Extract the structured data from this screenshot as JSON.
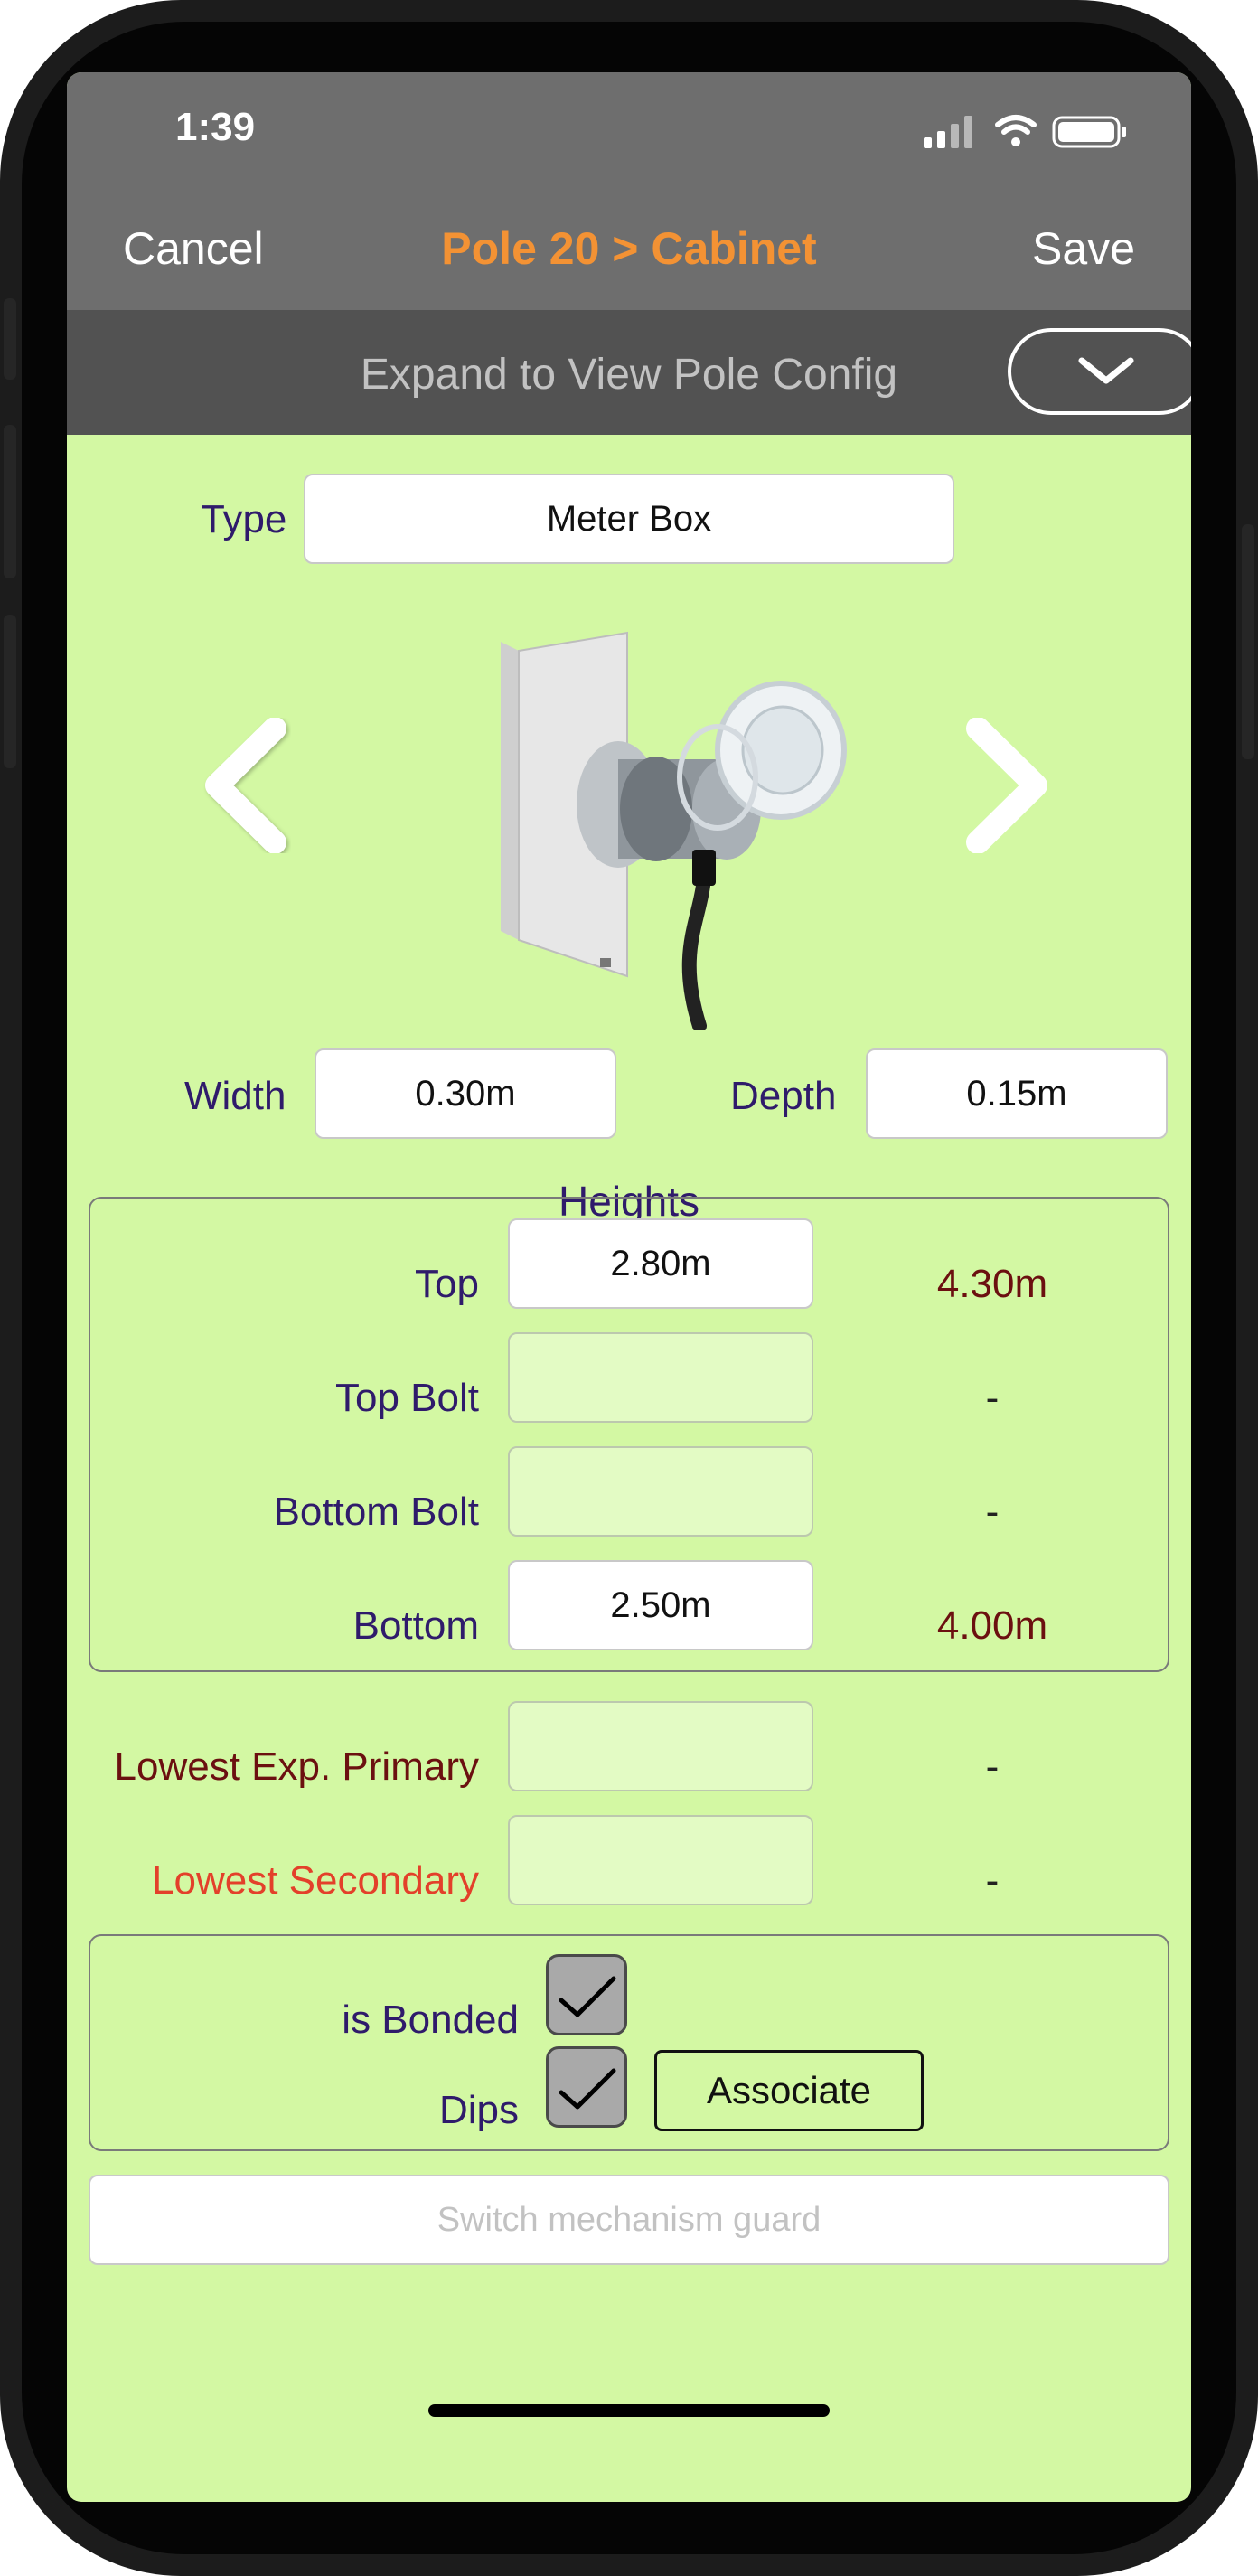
{
  "status": {
    "time": "1:39"
  },
  "nav": {
    "cancel": "Cancel",
    "title": "Pole 20 > Cabinet",
    "save": "Save"
  },
  "expand": {
    "label": "Expand to View Pole Config"
  },
  "type": {
    "label": "Type",
    "value": "Meter Box"
  },
  "dimensions": {
    "width_label": "Width",
    "width_value": "0.30m",
    "depth_label": "Depth",
    "depth_value": "0.15m"
  },
  "heights": {
    "title": "Heights",
    "rows": [
      {
        "label": "Top",
        "value": "2.80m",
        "computed": "4.30m"
      },
      {
        "label": "Top Bolt",
        "value": "",
        "computed": "-"
      },
      {
        "label": "Bottom Bolt",
        "value": "",
        "computed": "-"
      },
      {
        "label": "Bottom",
        "value": "2.50m",
        "computed": "4.00m"
      }
    ]
  },
  "lowest": [
    {
      "label": "Lowest Exp. Primary",
      "value": "",
      "computed": "-",
      "color": "#6b1010"
    },
    {
      "label": "Lowest Secondary",
      "value": "",
      "computed": "-",
      "color": "#e3402a"
    }
  ],
  "flags": {
    "bonded_label": "is Bonded",
    "bonded": true,
    "dips_label": "Dips",
    "dips": true,
    "associate_label": "Associate"
  },
  "switch_guard": {
    "placeholder": "Switch mechanism guard"
  },
  "colors": {
    "screen_bg": "#d3f8a3",
    "nav_title": "#f39234",
    "label": "#2f1b6b"
  }
}
